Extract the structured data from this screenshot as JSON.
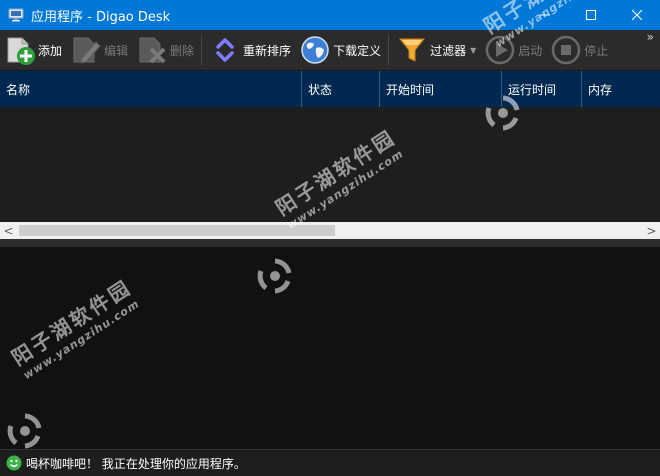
{
  "window": {
    "title": "应用程序 - Digao Desk",
    "minimize_glyph": "—",
    "maximize_glyph": "☐",
    "close_glyph": "✕"
  },
  "toolbar": {
    "add": "添加",
    "edit": "编辑",
    "delete": "删除",
    "reorder": "重新排序",
    "download_definitions": "下载定义",
    "filter": "过滤器",
    "start": "启动",
    "stop": "停止",
    "more": "»"
  },
  "grid": {
    "columns": [
      "名称",
      "状态",
      "开始时间",
      "运行时间",
      "内存"
    ]
  },
  "scrollbar": {
    "left": "<",
    "right": ">"
  },
  "status": {
    "message": "喝杯咖啡吧！ 我正在处理你的应用程序。"
  },
  "watermark": {
    "text": "阳子湖软件园",
    "url": "www.yangzihu.com"
  },
  "icons": {
    "app": "desk-app-icon",
    "add": "plus-icon",
    "edit": "pencil-icon",
    "delete": "delete-icon",
    "reorder": "up-down-icon",
    "download": "globe-icon",
    "filter": "funnel-icon",
    "start": "play-icon",
    "stop": "stop-icon",
    "status": "smiley-icon"
  },
  "colors": {
    "titlebar": "#0078d7",
    "toolbar": "#2b2b2b",
    "grid_header": "#002851",
    "grid_body": "#1e1e1e",
    "log_pane": "#111111"
  }
}
